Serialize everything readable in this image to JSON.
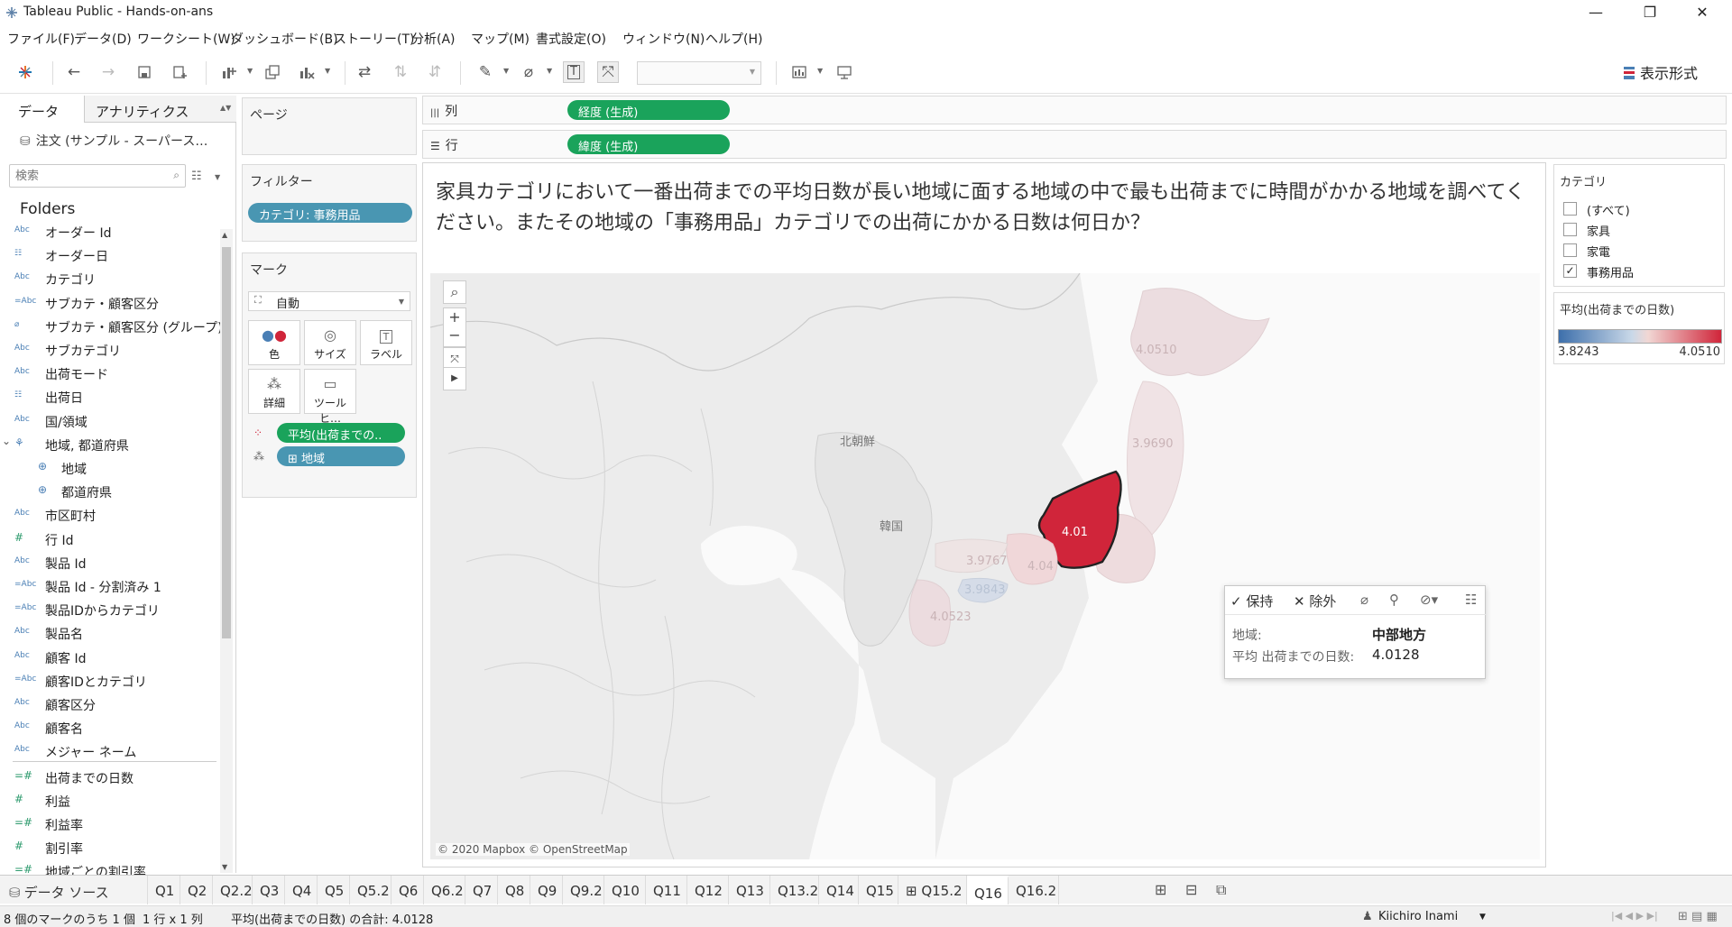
{
  "window": {
    "title": "Tableau Public - Hands-on-ans",
    "minimize": "—",
    "restore": "❐",
    "close": "✕"
  },
  "menu": [
    "ファイル(F)",
    "データ(D)",
    "ワークシート(W)",
    "ダッシュボード(B)",
    "ストーリー(T)",
    "分析(A)",
    "マップ(M)",
    "書式設定(O)",
    "ウィンドウ(N)",
    "ヘルプ(H)"
  ],
  "toolbar": {
    "show_me": "表示形式"
  },
  "data_pane": {
    "tab_data": "データ",
    "tab_analytics": "アナリティクス",
    "datasource": "注文 (サンプル - スーパース…",
    "search_placeholder": "検索",
    "folders_label": "Folders",
    "fields": [
      {
        "type": "Abc",
        "name": "オーダー Id"
      },
      {
        "type": "date",
        "name": "オーダー日"
      },
      {
        "type": "Abc",
        "name": "カテゴリ"
      },
      {
        "type": "=Abc",
        "name": "サブカテ・顧客区分"
      },
      {
        "type": "clip",
        "name": "サブカテ・顧客区分 (グループ)"
      },
      {
        "type": "Abc",
        "name": "サブカテゴリ"
      },
      {
        "type": "Abc",
        "name": "出荷モード"
      },
      {
        "type": "date",
        "name": "出荷日"
      },
      {
        "type": "Abc",
        "name": "国/領域"
      },
      {
        "type": "hier",
        "name": "地域, 都道府県"
      },
      {
        "type": "geo",
        "name": "地域"
      },
      {
        "type": "geo",
        "name": "都道府県"
      },
      {
        "type": "Abc",
        "name": "市区町村"
      },
      {
        "type": "#",
        "name": "行 Id"
      },
      {
        "type": "Abc",
        "name": "製品 Id"
      },
      {
        "type": "=Abc",
        "name": "製品 Id - 分割済み 1"
      },
      {
        "type": "=Abc",
        "name": "製品IDからカテゴリ"
      },
      {
        "type": "Abc",
        "name": "製品名"
      },
      {
        "type": "Abc",
        "name": "顧客 Id"
      },
      {
        "type": "=Abc",
        "name": "顧客IDとカテゴリ"
      },
      {
        "type": "Abc",
        "name": "顧客区分"
      },
      {
        "type": "Abc",
        "name": "顧客名"
      },
      {
        "type": "Abc",
        "name": "メジャー ネーム"
      },
      {
        "type": "=#",
        "name": "出荷までの日数"
      },
      {
        "type": "#",
        "name": "利益"
      },
      {
        "type": "=#",
        "name": "利益率"
      },
      {
        "type": "#",
        "name": "割引率"
      },
      {
        "type": "=#",
        "name": "地域ごとの割引率"
      }
    ]
  },
  "pages_label": "ページ",
  "filters": {
    "label": "フィルター",
    "pill": "カテゴリ: 事務用品"
  },
  "marks": {
    "label": "マーク",
    "type": "自動",
    "buttons": [
      "色",
      "サイズ",
      "ラベル",
      "詳細",
      "ツールヒ…"
    ],
    "pill_color": "平均(出荷までの..",
    "pill_detail": "⊞ 地域"
  },
  "columns": {
    "label": "列",
    "pill": "経度 (生成)"
  },
  "rows": {
    "label": "行",
    "pill": "緯度 (生成)"
  },
  "question": "家具カテゴリにおいて一番出荷までの平均日数が長い地域に面する地域の中で最も出荷までに時間がかかる地域を調べてください。またその地域の「事務用品」カテゴリでの出荷にかかる日数は何日か？",
  "map": {
    "attribution": "© 2020 Mapbox © OpenStreetMap",
    "label_nk": "北朝鮮",
    "label_kr": "韓国",
    "values": [
      "4.0510",
      "3.9690",
      "4.0128",
      "3.9767",
      "4.04",
      "3.9843",
      "4.0523"
    ]
  },
  "tooltip": {
    "keep": "保持",
    "exclude": "除外",
    "region_key": "地域:",
    "region_val": "中部地方",
    "avg_key": "平均 出荷までの日数:",
    "avg_val": "4.0128"
  },
  "category_filter": {
    "title": "カテゴリ",
    "options": [
      {
        "label": "(すべて)",
        "checked": false
      },
      {
        "label": "家具",
        "checked": false
      },
      {
        "label": "家電",
        "checked": false
      },
      {
        "label": "事務用品",
        "checked": true
      }
    ]
  },
  "color_legend": {
    "title": "平均(出荷までの日数)",
    "min": "3.8243",
    "max": "4.0510",
    "colors": [
      "#3d6fab",
      "#c9d8e8",
      "#f1d7d4",
      "#d0253a"
    ]
  },
  "sheet_tabs": {
    "datasource": "データ ソース",
    "sheets": [
      "Q1",
      "Q2",
      "Q2.2",
      "Q3",
      "Q4",
      "Q5",
      "Q5.2",
      "Q6",
      "Q6.2",
      "Q7",
      "Q8",
      "Q9",
      "Q9.2",
      "Q10",
      "Q11",
      "Q12",
      "Q13",
      "Q13.2",
      "Q14",
      "Q15",
      "⊞ Q15.2",
      "Q16",
      "Q16.2"
    ],
    "active": "Q16"
  },
  "status": {
    "marks": "8 個のマークのうち 1 個",
    "dims": "1 行 x 1 列",
    "sum": "平均(出荷までの日数) の合計: 4.0128",
    "user": "Kiichiro Inami"
  }
}
